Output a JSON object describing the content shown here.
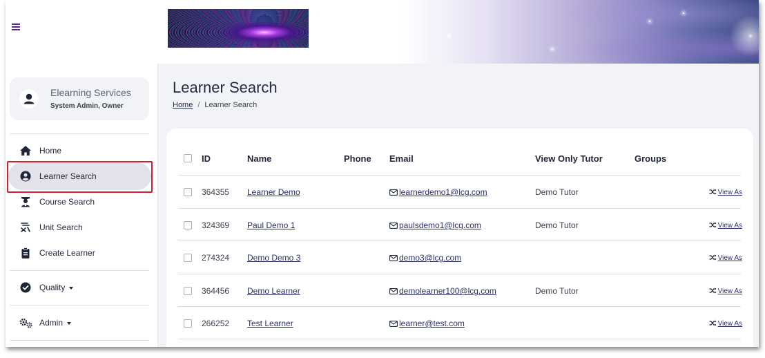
{
  "header": {
    "menu_icon": "hamburger-menu-icon"
  },
  "user": {
    "name": "Elearning Services",
    "role": "System Admin, Owner"
  },
  "sidebar": {
    "items": [
      {
        "label": "Home",
        "icon": "home-icon"
      },
      {
        "label": "Learner Search",
        "icon": "user-circle-icon",
        "active": true
      },
      {
        "label": "Course Search",
        "icon": "graduate-icon"
      },
      {
        "label": "Unit Search",
        "icon": "unit-search-icon"
      },
      {
        "label": "Create Learner",
        "icon": "clipboard-icon"
      }
    ],
    "quality": {
      "label": "Quality",
      "icon": "check-circle-icon"
    },
    "admin": {
      "label": "Admin",
      "icon": "cogs-icon"
    }
  },
  "page": {
    "title": "Learner Search",
    "breadcrumb": {
      "home": "Home",
      "separator": "/",
      "current": "Learner Search"
    }
  },
  "table": {
    "headers": {
      "id": "ID",
      "name": "Name",
      "phone": "Phone",
      "email": "Email",
      "tutor": "View Only Tutor",
      "groups": "Groups"
    },
    "view_as_label": "View As",
    "rows": [
      {
        "id": "364355",
        "name": "Learner Demo",
        "phone": "",
        "email": "learnerdemo1@lcg.com",
        "tutor": "Demo Tutor"
      },
      {
        "id": "324369",
        "name": "Paul Demo 1",
        "phone": "",
        "email": "paulsdemo1@lcg.com",
        "tutor": "Demo Tutor"
      },
      {
        "id": "274324",
        "name": "Demo Demo 3",
        "phone": "",
        "email": "demo3@lcg.com",
        "tutor": ""
      },
      {
        "id": "364456",
        "name": "Demo Learner",
        "phone": "",
        "email": "demolearner100@lcg.com",
        "tutor": "Demo Tutor"
      },
      {
        "id": "266252",
        "name": "Test Learner",
        "phone": "",
        "email": "learner@test.com",
        "tutor": ""
      }
    ]
  },
  "colors": {
    "accent": "#5a2a8a",
    "highlight": "#d21f2f",
    "title": "#1f2a44"
  }
}
